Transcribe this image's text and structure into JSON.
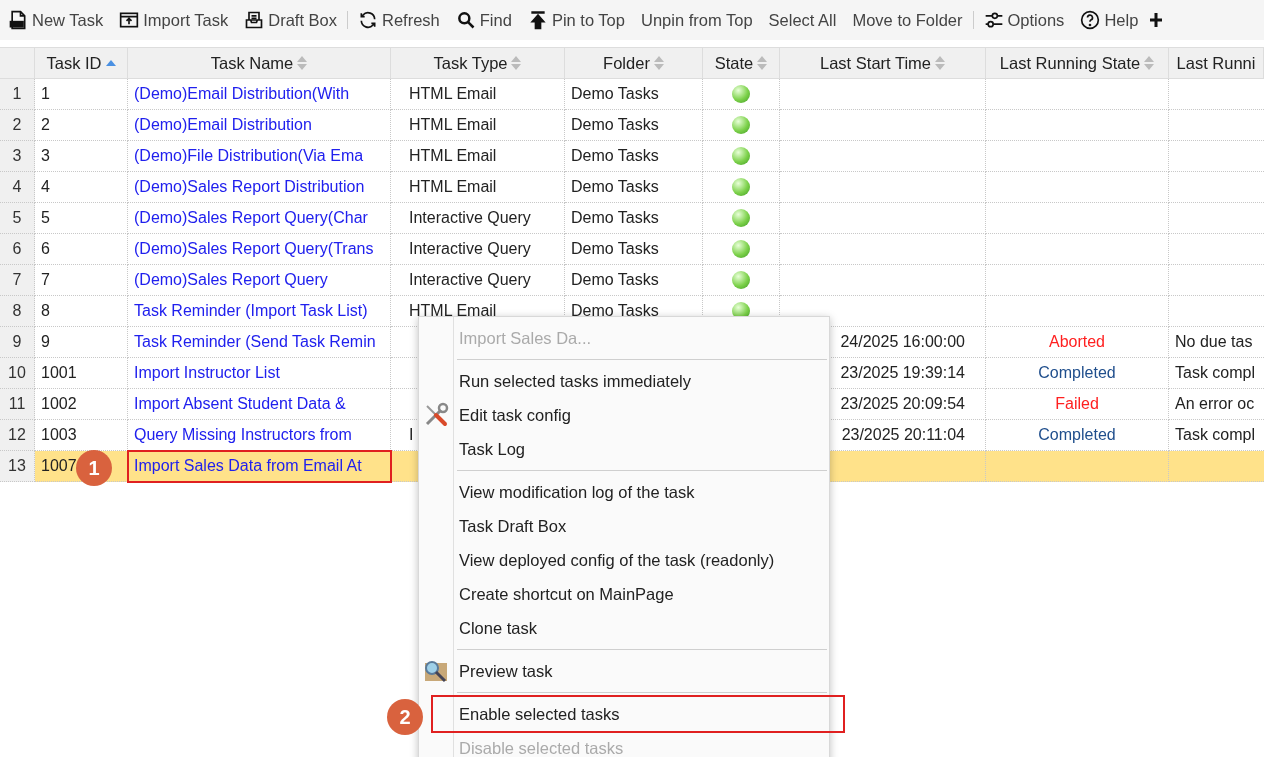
{
  "toolbar": [
    {
      "kind": "new",
      "label": "New Task"
    },
    {
      "kind": "import",
      "label": "Import Task"
    },
    {
      "kind": "draft",
      "label": "Draft Box"
    },
    {
      "kind": "separator"
    },
    {
      "kind": "refresh",
      "label": "Refresh"
    },
    {
      "kind": "find",
      "label": "Find"
    },
    {
      "kind": "pin",
      "label": "Pin to Top"
    },
    {
      "kind": "text",
      "label": "Unpin from Top"
    },
    {
      "kind": "text",
      "label": "Select All"
    },
    {
      "kind": "text",
      "label": "Move to Folder"
    },
    {
      "kind": "separator"
    },
    {
      "kind": "options",
      "label": "Options"
    },
    {
      "kind": "help",
      "label": "Help"
    },
    {
      "kind": "more"
    }
  ],
  "table": {
    "columns": [
      {
        "label": "Task ID",
        "sorted": true
      },
      {
        "label": "Task Name",
        "sorted": false
      },
      {
        "label": "Task Type",
        "sorted": false
      },
      {
        "label": "Folder",
        "sorted": false
      },
      {
        "label": "State",
        "sorted": false
      },
      {
        "label": "Last Start Time",
        "sorted": false
      },
      {
        "label": "Last Running State",
        "sorted": false
      },
      {
        "label": "Last Runni"
      }
    ],
    "rows": [
      {
        "num": "1",
        "id": "1",
        "name": "(Demo)Email Distribution(With",
        "type": "HTML Email",
        "folder": "Demo Tasks",
        "enabled": true,
        "selected": false
      },
      {
        "num": "2",
        "id": "2",
        "name": "(Demo)Email Distribution",
        "type": "HTML Email",
        "folder": "Demo Tasks",
        "enabled": true,
        "selected": false
      },
      {
        "num": "3",
        "id": "3",
        "name": "(Demo)File Distribution(Via Ema",
        "type": "HTML Email",
        "folder": "Demo Tasks",
        "enabled": true,
        "selected": false
      },
      {
        "num": "4",
        "id": "4",
        "name": "(Demo)Sales Report Distribution",
        "type": "HTML Email",
        "folder": "Demo Tasks",
        "enabled": true,
        "selected": false
      },
      {
        "num": "5",
        "id": "5",
        "name": "(Demo)Sales Report Query(Char",
        "type": "Interactive Query",
        "folder": "Demo Tasks",
        "enabled": true,
        "selected": false
      },
      {
        "num": "6",
        "id": "6",
        "name": "(Demo)Sales Report Query(Trans",
        "type": "Interactive Query",
        "folder": "Demo Tasks",
        "enabled": true,
        "selected": false
      },
      {
        "num": "7",
        "id": "7",
        "name": "(Demo)Sales Report Query",
        "type": "Interactive Query",
        "folder": "Demo Tasks",
        "enabled": true,
        "selected": false
      },
      {
        "num": "8",
        "id": "8",
        "name": "Task Reminder (Import Task List)",
        "type": "HTML Email",
        "folder": "Demo Tasks",
        "enabled": true,
        "selected": false
      },
      {
        "num": "9",
        "id": "9",
        "name": "Task Reminder (Send Task Remin",
        "start": "24/2025 16:00:00",
        "result": {
          "kind": "aborted",
          "label": "Aborted"
        },
        "message": "No due tas",
        "selected": false
      },
      {
        "num": "10",
        "id": "1001",
        "name": "Import Instructor List",
        "start": "23/2025 19:39:14",
        "result": {
          "kind": "completed",
          "label": "Completed"
        },
        "message": "Task compl",
        "selected": false
      },
      {
        "num": "11",
        "id": "1002",
        "name": "Import Absent Student Data &",
        "start": "23/2025 20:09:54",
        "result": {
          "kind": "failed",
          "label": "Failed"
        },
        "message": "An error oc",
        "selected": false
      },
      {
        "num": "12",
        "id": "1003",
        "name": "Query Missing Instructors from",
        "type": "I",
        "start": "23/2025 20:11:04",
        "result": {
          "kind": "completed",
          "label": "Completed"
        },
        "message": "Task compl",
        "selected": false
      },
      {
        "num": "13",
        "id": "1007",
        "name": "Import Sales Data from Email At",
        "selected": true,
        "callout": "1"
      }
    ]
  },
  "context_menu": {
    "items": [
      {
        "kind": "title",
        "label": "Import Sales Da...",
        "disabled": true
      },
      {
        "kind": "separator"
      },
      {
        "kind": "plain",
        "label": "Run selected tasks immediately",
        "disabled": false
      },
      {
        "kind": "wrench",
        "label": "Edit task config",
        "disabled": false
      },
      {
        "kind": "plain",
        "label": "Task Log",
        "disabled": false
      },
      {
        "kind": "separator"
      },
      {
        "kind": "plain",
        "label": "View modification log of the task",
        "disabled": false
      },
      {
        "kind": "plain",
        "label": "Task Draft Box",
        "disabled": false
      },
      {
        "kind": "plain",
        "label": "View deployed config of the task (readonly)",
        "disabled": false
      },
      {
        "kind": "plain",
        "label": "Create shortcut on MainPage",
        "disabled": false
      },
      {
        "kind": "plain",
        "label": "Clone task",
        "disabled": false
      },
      {
        "kind": "separator"
      },
      {
        "kind": "magnifier",
        "label": "Preview task",
        "disabled": false
      },
      {
        "kind": "separator"
      },
      {
        "kind": "plain",
        "label": "Enable selected tasks",
        "disabled": false,
        "callout": "2"
      },
      {
        "kind": "plain",
        "label": "Disable selected tasks",
        "disabled": true
      }
    ]
  }
}
